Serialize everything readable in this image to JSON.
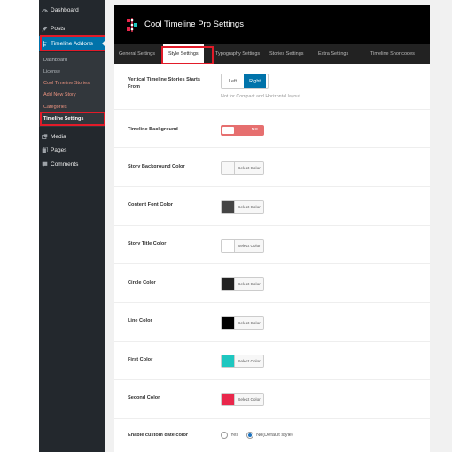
{
  "sidebar": {
    "menu": [
      {
        "label": "Dashboard",
        "icon": "dashboard-icon"
      },
      {
        "label": "Posts",
        "icon": "pin-icon"
      },
      {
        "label": "Timeline Addons",
        "icon": "timeline-icon"
      },
      {
        "label": "Media",
        "icon": "media-icon"
      },
      {
        "label": "Pages",
        "icon": "pages-icon"
      },
      {
        "label": "Comments",
        "icon": "comments-icon"
      }
    ],
    "submenu": [
      {
        "label": "Dashboard"
      },
      {
        "label": "License"
      },
      {
        "label": "Cool Timeline Stories"
      },
      {
        "label": "Add New Story"
      },
      {
        "label": "Categories"
      },
      {
        "label": "Timeline Settings"
      }
    ]
  },
  "header": {
    "title": "Cool Timeline Pro Settings"
  },
  "tabs": [
    {
      "label": "General Settings"
    },
    {
      "label": "Style Settings"
    },
    {
      "label": "Typography Settings"
    },
    {
      "label": "Stories Settings"
    },
    {
      "label": "Extra Settings"
    },
    {
      "label": "Timeline Shortcodes"
    }
  ],
  "settings": {
    "stories_start": {
      "label": "Vertical Timeline Stories Starts From",
      "left": "Left",
      "right": "Right",
      "selected": "Right",
      "hint": "Not for Compact and Horizontal layout"
    },
    "timeline_background": {
      "label": "Timeline Background",
      "toggle_text": "NO"
    },
    "color_pickers": [
      {
        "label": "Story Background Color",
        "color": "#f7f7f7",
        "button": "Select Color"
      },
      {
        "label": "Content Font Color",
        "color": "#444444",
        "button": "Select Color"
      },
      {
        "label": "Story Title Color",
        "color": "#ffffff",
        "button": "Select Color"
      },
      {
        "label": "Circle Color",
        "color": "#222222",
        "button": "Select Color"
      },
      {
        "label": "Line Color",
        "color": "#000000",
        "button": "Select Color"
      },
      {
        "label": "First Color",
        "color": "#1ec7c0",
        "button": "Select Color"
      },
      {
        "label": "Second Color",
        "color": "#e9274b",
        "button": "Select Color"
      }
    ],
    "custom_date_color": {
      "label": "Enable custom date color",
      "options": [
        "Yes",
        "No(Default style)"
      ],
      "selected": "No(Default style)"
    }
  },
  "colors": {
    "admin_bg": "#23282d",
    "accent_blue": "#0073aa",
    "highlight_red": "#e21b29",
    "toggle_red": "#e66f6f"
  }
}
